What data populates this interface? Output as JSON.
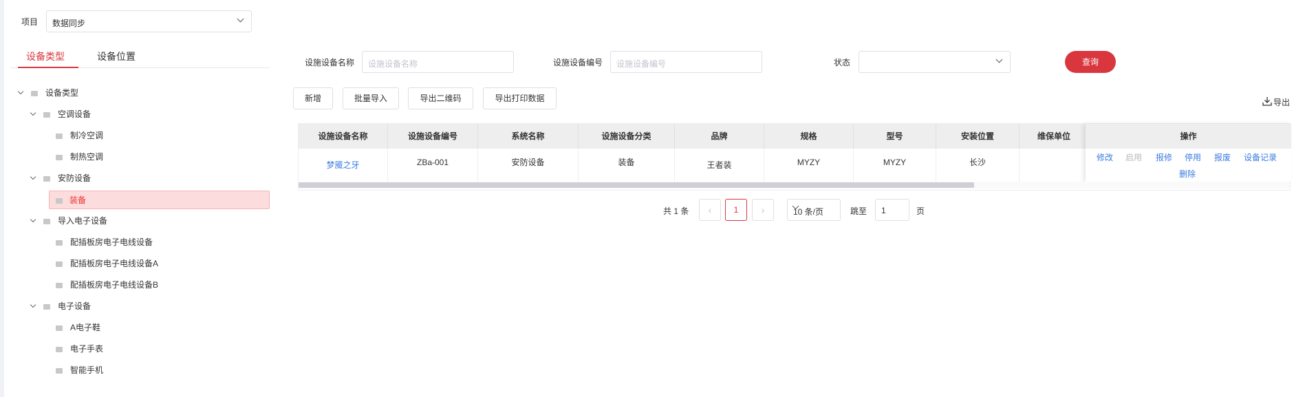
{
  "project": {
    "label": "项目",
    "value": "数据同步"
  },
  "tabs": [
    "设备类型",
    "设备位置"
  ],
  "tree": [
    {
      "label": "设备类型",
      "expanded": true
    },
    {
      "label": "空调设备",
      "expanded": true
    },
    {
      "label": "制冷空调"
    },
    {
      "label": "制热空调"
    },
    {
      "label": "安防设备",
      "expanded": true
    },
    {
      "label": "装备",
      "selected": true
    },
    {
      "label": "导入电子设备",
      "expanded": true
    },
    {
      "label": "配插板房电子电线设备"
    },
    {
      "label": "配插板房电子电线设备A"
    },
    {
      "label": "配插板房电子电线设备B"
    },
    {
      "label": "电子设备",
      "expanded": true
    },
    {
      "label": "A电子鞋"
    },
    {
      "label": "电子手表"
    },
    {
      "label": "智能手机"
    }
  ],
  "filters": {
    "name_label": "设施设备名称",
    "name_placeholder": "设施设备名称",
    "code_label": "设施设备编号",
    "code_placeholder": "设施设备编号",
    "status_label": "状态",
    "status_value": "",
    "query": "查询"
  },
  "toolbar": {
    "add": "新增",
    "import": "批量导入",
    "export_qr": "导出二维码",
    "export_print": "导出打印数据",
    "export": "导出"
  },
  "table": {
    "columns": [
      "设施设备名称",
      "设施设备编号",
      "系统名称",
      "设施设备分类",
      "品牌",
      "规格",
      "型号",
      "安装位置",
      "维保单位",
      "操作"
    ],
    "rows": [
      {
        "name": "梦魇之牙",
        "code": "ZBa-001",
        "system": "安防设备",
        "category": "装备",
        "brand": "王者装",
        "spec": "MYZY",
        "model": "MYZY",
        "location": "长沙",
        "maintainer": ""
      }
    ],
    "actions": [
      "修改",
      "启用",
      "报修",
      "停用",
      "报废",
      "设备记录",
      "删除"
    ]
  },
  "pagination": {
    "total_text": "共 1 条",
    "current_page": "1",
    "page_size": "10 条/页",
    "jump_label": "跳至",
    "jump_value": "1",
    "page_unit": "页"
  },
  "colors": {
    "accent": "#d9363e",
    "link": "#3a7be0"
  }
}
